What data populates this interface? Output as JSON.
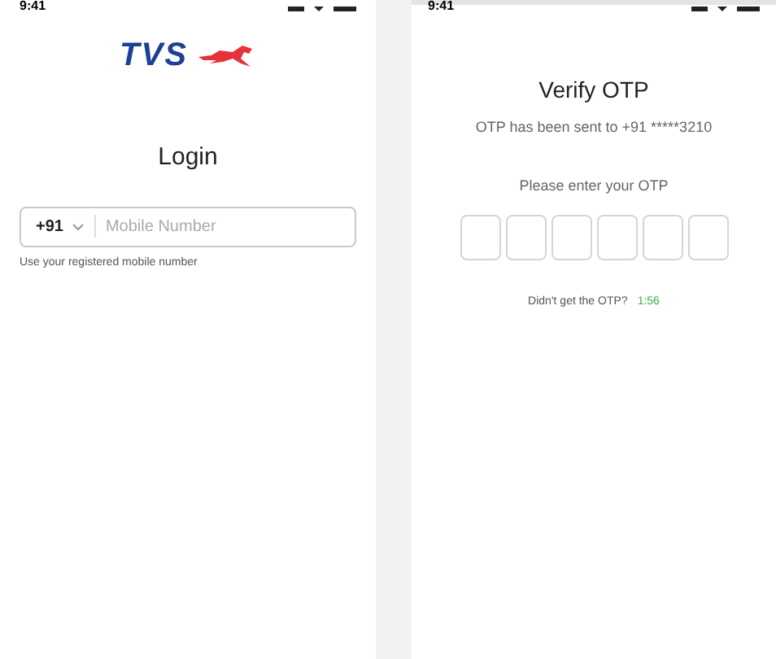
{
  "login_screen": {
    "status_time": "9:41",
    "logo_text": "TVS",
    "title": "Login",
    "country_code": "+91",
    "phone_placeholder": "Mobile Number",
    "hint": "Use your registered mobile number"
  },
  "otp_screen": {
    "status_time": "9:41",
    "title": "Verify OTP",
    "sent_message": "OTP has been sent to +91 *****3210",
    "prompt": "Please enter your OTP",
    "otp_boxes": [
      {
        "filled": false
      },
      {
        "filled": false
      },
      {
        "filled": false
      },
      {
        "filled": false
      },
      {
        "filled": false
      },
      {
        "filled": false
      }
    ],
    "resend_label": "Didn't get the OTP?",
    "countdown": "1:56"
  }
}
